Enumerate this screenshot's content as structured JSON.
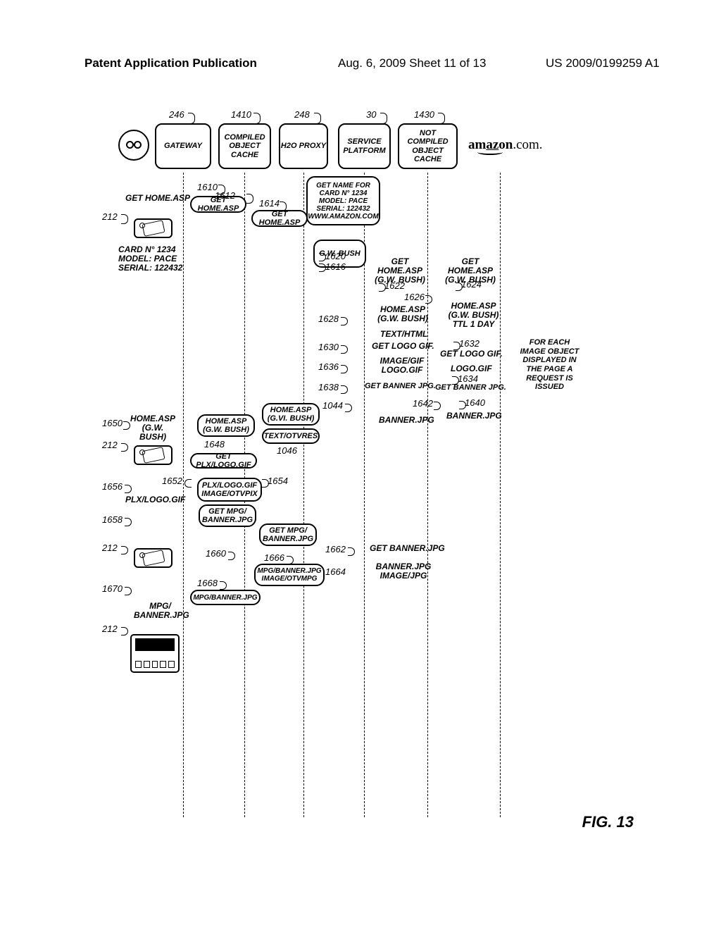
{
  "header": {
    "left": "Patent Application Publication",
    "center": "Aug. 6, 2009  Sheet 11 of 13",
    "right": "US 2009/0199259 A1"
  },
  "lanes": {
    "gateway": "GATEWAY",
    "compiled_cache": "COMPILED OBJECT CACHE",
    "h2o_proxy": "H2O PROXY",
    "service_platform": "SERVICE PLATFORM",
    "not_compiled_cache": "NOT COMPILED OBJECT CACHE",
    "amazon_text": "amazon.com."
  },
  "lane_refs": {
    "r246": "246",
    "r1410": "1410",
    "r248": "248",
    "r30": "30",
    "r1430": "1430"
  },
  "boxes": {
    "b1612": "GET HOME.ASP",
    "b1614": "GET HOME.ASP",
    "get_name_box": "GET NAME FOR CARD N° 1234 MODEL: PACE SERIAL: 122432 WWW.AMAZON.COM",
    "b1616": "G.W. BUSH",
    "home_gw_left": "HOME.ASP (G.W. BUSH)",
    "home_gw_mid": "HOME.ASP (G.VI. BUSH)",
    "text_otvres": "TEXT/OTVRES",
    "get_plx_logo": "GET PLX/LOGO.GIF",
    "plx_logo": "PLX/LOGO.GIF IMAGE/OTVPIX",
    "get_mpg_banner": "GET MPG/ BANNER.JPG",
    "get_mpg_banner2": "GET MPG/ BANNER.JPG",
    "mpg_banner_jpg": "MPG/BANNER.JPG IMAGE/OTVMPG",
    "mpg_banner_jpg2": "MPG/BANNER.JPG"
  },
  "labels": {
    "get_home_asp_1610": "GET HOME.ASP",
    "card_info_1": "CARD N° 1234",
    "card_info_2": "MODEL: PACE",
    "card_info_3": "SERIAL: 122432",
    "get_home_gw_1622": "GET HOME.ASP (G.W. BUSH)",
    "get_home_gw_1624": "GET HOME.ASP (G.W. BUSH)",
    "home_gw_1626": "HOME.ASP (G.W. BUSH)",
    "home_gw_ttl": "HOME.ASP (G.W. BUSH) TTL 1 DAY",
    "text_html": "TEXT/HTML",
    "get_logo_gif": "GET LOGO GIF.",
    "get_logo_gif2": "GET LOGO GIF.",
    "image_gif_logo": "IMAGE/GIF LOGO.GIF",
    "logo_gif": "LOGO.GIF",
    "get_banner_jpg": "GET BANNER JPG.",
    "get_banner_jpg2": "GET BANNER JPG.",
    "banner_jpg": "BANNER.JPG",
    "banner_jpg2": "BANNER.JPG",
    "get_banner_1662": "GET BANNER.JPG",
    "banner_img_jpg": "BANNER.JPG IMAGE/JPG",
    "home_asp_gw_1650": "HOME.ASP (G.W. BUSH)",
    "plx_logo_gif_1656": "PLX/LOGO.GIF",
    "mpg_banner_1670": "MPG/ BANNER.JPG"
  },
  "refs": {
    "r1610": "1610",
    "r1612": "1612",
    "r1614": "1614",
    "r212a": "212",
    "r1620": "1620",
    "r1616": "1616",
    "r1622": "1622",
    "r1624": "1624",
    "r1626": "1626",
    "r1628": "1628",
    "r1630": "1630",
    "r1632": "1632",
    "r1634": "1634",
    "r1636": "1636",
    "r1638": "1638",
    "r1640": "1640",
    "r1642": "1642",
    "r1044": "1044",
    "r1046": "1046",
    "r1648": "1648",
    "r1650": "1650",
    "r212b": "212",
    "r1652": "1652",
    "r1654": "1654",
    "r1656": "1656",
    "r1658": "1658",
    "r1660": "1660",
    "r1662": "1662",
    "r1664": "1664",
    "r1666": "1666",
    "r1668": "1668",
    "r1670": "1670",
    "r212c": "212",
    "r212d": "212"
  },
  "side_note": "FOR EACH IMAGE OBJECT DISPLAYED IN THE PAGE A REQUEST IS ISSUED",
  "figure_label": "FIG. 13"
}
